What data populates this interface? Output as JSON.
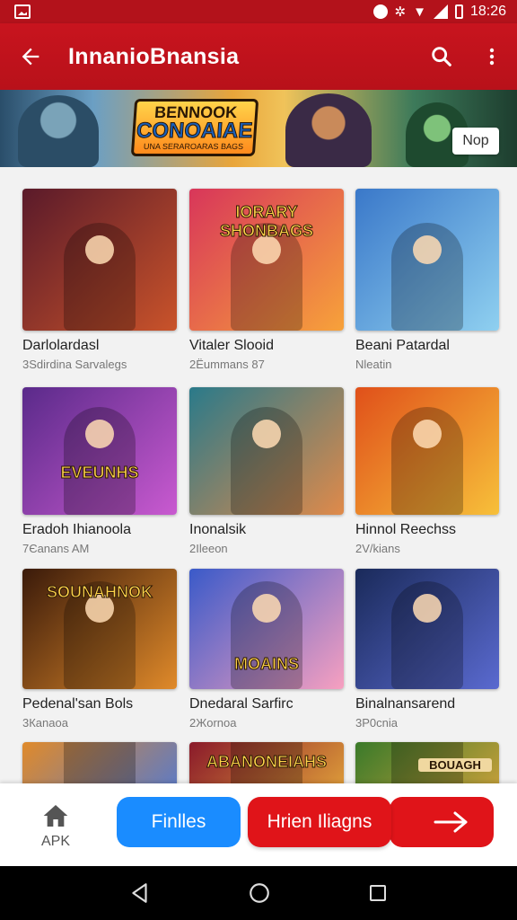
{
  "status_bar": {
    "time": "18:26",
    "icons": [
      "gallery-icon",
      "notification-dot-icon",
      "settings-icon",
      "wifi-icon",
      "signal-icon",
      "battery-icon"
    ]
  },
  "app_bar": {
    "title": "InnanioВnansia",
    "icons": [
      "arrow-back-icon",
      "share-icon",
      "more-vert-icon"
    ]
  },
  "banner": {
    "logo_line1": "BENNOOK",
    "logo_line2": "CONOAIAE",
    "logo_line3": "UNA SERAROARAS BAGS",
    "ad_button": "Nop"
  },
  "games": [
    {
      "name": "Darlolardasl",
      "meta": "3Ѕdirdina Sarvalegs",
      "art_text": "",
      "colors": [
        "#5a1a2a",
        "#c9532a"
      ]
    },
    {
      "name": "Vitaler Slooid",
      "meta": "2Ёummans 87",
      "art_text": "IORARY SHONBAGS",
      "colors": [
        "#d8365a",
        "#f7a23a"
      ]
    },
    {
      "name": "Beani Patardal",
      "meta": "Nleatin",
      "art_text": "",
      "colors": [
        "#3a78c9",
        "#8fd0f0"
      ]
    },
    {
      "name": "Eradoh Ihianoola",
      "meta": "7Єanans AM",
      "art_text": "EVEUNHS",
      "colors": [
        "#5a2a8a",
        "#c95ad0"
      ]
    },
    {
      "name": "Inonalsik",
      "meta": "2Іleeon",
      "art_text": "",
      "colors": [
        "#2a7a8a",
        "#e08a4a"
      ]
    },
    {
      "name": "Hinnol Reechss",
      "meta": "2V/kians",
      "art_text": "",
      "colors": [
        "#e0501a",
        "#f7c03a"
      ]
    },
    {
      "name": "Pedenal'san Bols",
      "meta": "3Каnaoa",
      "art_text": "SOUNAHNOK",
      "colors": [
        "#3a1a0a",
        "#e08a2a"
      ]
    },
    {
      "name": "Dnedaral Sarfirc",
      "meta": "2Жornoa",
      "art_text": "MOAINS",
      "colors": [
        "#3a5ac9",
        "#f7a0c0"
      ]
    },
    {
      "name": "Binalnansarend",
      "meta": "3Р0cniа",
      "art_text": "",
      "colors": [
        "#1a2a5a",
        "#5a6ad0"
      ]
    },
    {
      "name": "",
      "meta": "",
      "art_text": "",
      "colors": [
        "#e08a2a",
        "#5a7ac9"
      ]
    },
    {
      "name": "",
      "meta": "",
      "art_text": "ABANONEIAHS",
      "colors": [
        "#8a1a2a",
        "#e0a03a"
      ]
    },
    {
      "name": "",
      "meta": "",
      "art_text": "BOUAGH",
      "colors": [
        "#3a7a2a",
        "#c9a03a"
      ]
    }
  ],
  "bottom_bar": {
    "apk_label": "APK",
    "primary_button": "Finlles",
    "secondary_button": "Hrien Iliagns"
  },
  "nav_bar": {
    "icons": [
      "back-triangle-icon",
      "home-circle-icon",
      "recents-square-icon"
    ]
  }
}
